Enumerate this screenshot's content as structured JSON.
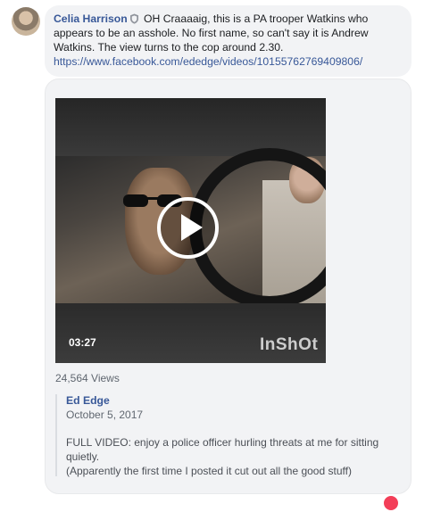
{
  "comment": {
    "author": "Celia Harrison",
    "badge_icon": "shield-icon",
    "text": "OH Craaaaig, this is a PA trooper Watkins who appears to be an asshole. No first name, so can't say it is Andrew Watkins. The view turns to the cop around 2.30.",
    "link": "https://www.facebook.com/ededge/videos/10155762769409806/"
  },
  "video": {
    "duration": "03:27",
    "watermark": "InShOt",
    "views": "24,564 Views"
  },
  "shared_post": {
    "author": "Ed Edge",
    "date": "October 5, 2017",
    "text_line1": "FULL VIDEO: enjoy a police officer hurling threats at me for sitting quietly.",
    "text_line2": "(Apparently the first time I posted it cut out all the good stuff)"
  },
  "colors": {
    "link_blue": "#385898",
    "bubble_gray": "#f2f3f5",
    "reaction_red": "#f33e58"
  }
}
